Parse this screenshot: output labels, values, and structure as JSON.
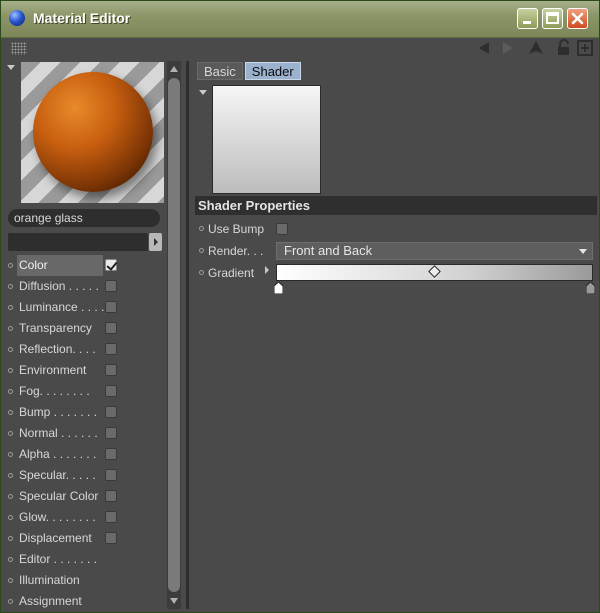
{
  "window": {
    "title": "Material Editor",
    "colors": {
      "titlebar": "#8d9668",
      "close": "#d04a1e",
      "accent": "#9bb2cf",
      "panel": "#4a4a4a"
    }
  },
  "toolbar": {
    "icons": [
      "grip-icon",
      "back-arrow-icon",
      "forward-arrow-icon",
      "up-arrow-icon",
      "lock-icon",
      "new-window-icon"
    ]
  },
  "material": {
    "name": "orange glass",
    "preview_color": "#c85f10"
  },
  "channels": [
    {
      "label": "Color",
      "has_checkbox": true,
      "checked": true,
      "selected": true
    },
    {
      "label": "Diffusion . . . . .",
      "has_checkbox": true,
      "checked": false
    },
    {
      "label": "Luminance . . . .",
      "has_checkbox": true,
      "checked": false
    },
    {
      "label": "Transparency",
      "has_checkbox": true,
      "checked": false
    },
    {
      "label": "Reflection. . . .",
      "has_checkbox": true,
      "checked": false
    },
    {
      "label": "Environment",
      "has_checkbox": true,
      "checked": false
    },
    {
      "label": "Fog. . . . . . . .",
      "has_checkbox": true,
      "checked": false
    },
    {
      "label": "Bump . . . . . . .",
      "has_checkbox": true,
      "checked": false
    },
    {
      "label": "Normal . . . . . .",
      "has_checkbox": true,
      "checked": false
    },
    {
      "label": "Alpha . . . . . . .",
      "has_checkbox": true,
      "checked": false
    },
    {
      "label": "Specular. . . . .",
      "has_checkbox": true,
      "checked": false
    },
    {
      "label": "Specular Color",
      "has_checkbox": true,
      "checked": false
    },
    {
      "label": "Glow. . . . . . . .",
      "has_checkbox": true,
      "checked": false
    },
    {
      "label": "Displacement",
      "has_checkbox": true,
      "checked": false
    },
    {
      "label": "Editor . . . . . . .",
      "has_checkbox": false
    },
    {
      "label": "Illumination",
      "has_checkbox": false
    },
    {
      "label": "Assignment",
      "has_checkbox": false
    }
  ],
  "tabs": [
    {
      "label": "Basic",
      "active": false
    },
    {
      "label": "Shader",
      "active": true
    }
  ],
  "shader": {
    "section_title": "Shader Properties",
    "use_bump_label": "Use Bump",
    "use_bump_checked": false,
    "render_label": "Render. . .",
    "render_value": "Front and Back",
    "gradient_label": "Gradient",
    "gradient_stops": [
      "#ffffff",
      "#d2d2d2",
      "#9a9a9a"
    ]
  }
}
